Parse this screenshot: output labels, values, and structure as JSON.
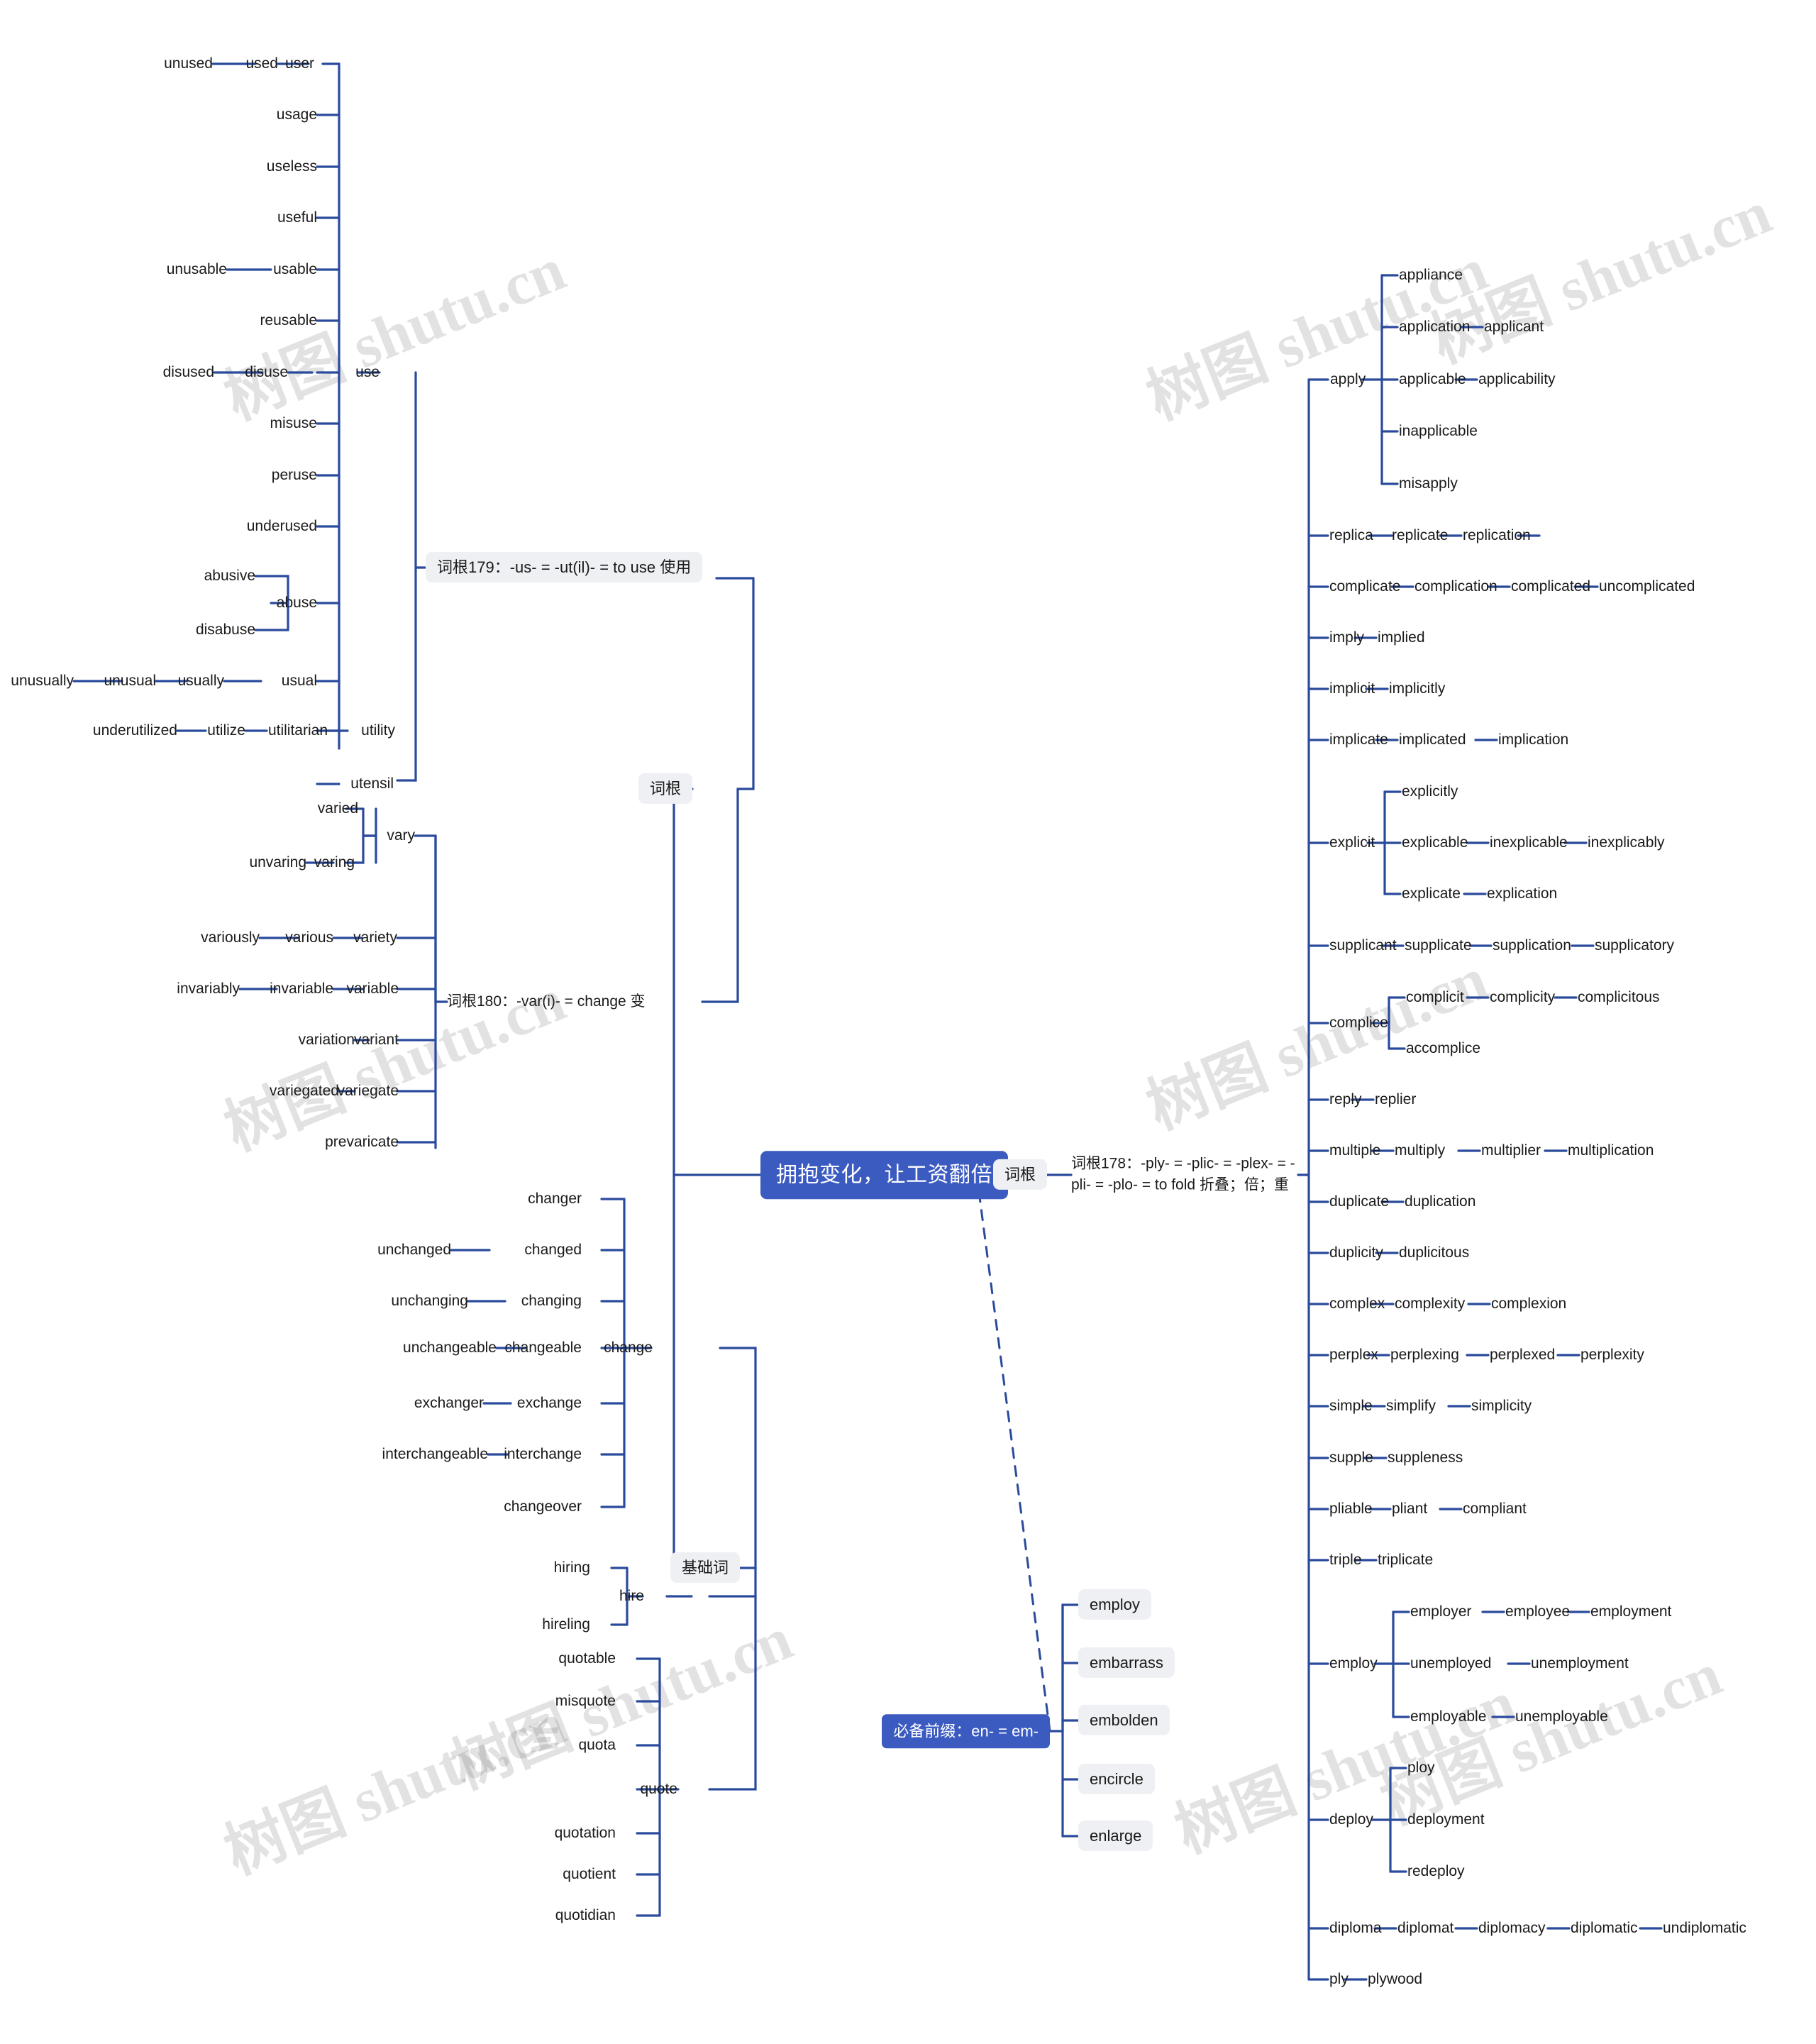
{
  "meta": {
    "watermark_text": "树图 shutu.cn",
    "accent_color": "#3b5bc0",
    "line_color": "#2a4a9c",
    "chip_bg": "#eef0f3"
  },
  "root": {
    "label": "拥抱变化，让工资翻倍"
  },
  "branches": {
    "cigen_left": {
      "label": "词根"
    },
    "cigen_right": {
      "label": "词根"
    },
    "jichuci": {
      "label": "基础词"
    },
    "bibei_qianzhui": {
      "label": "必备前缀：en- = em-"
    }
  },
  "roots": {
    "r179": {
      "label": "词根179：-us- = -ut(il)- = to use 使用"
    },
    "r180": {
      "label": "词根180：-var(i)- = change 变"
    },
    "r178": {
      "label": "词根178：-ply- = -plic- = -plex- = -pli- = -plo- = to fold 折叠；倍；重"
    }
  },
  "words": {
    "unused": "unused",
    "used": "used",
    "user": "user",
    "usage": "usage",
    "useless": "useless",
    "useful": "useful",
    "unusable": "unusable",
    "usable": "usable",
    "reusable": "reusable",
    "disused": "disused",
    "disuse": "disuse",
    "use": "use",
    "misuse": "misuse",
    "peruse": "peruse",
    "underused": "underused",
    "abusive": "abusive",
    "abuse": "abuse",
    "disabuse": "disabuse",
    "unusually": "unusually",
    "unusual": "unusual",
    "usually": "usually",
    "usual": "usual",
    "underutilized": "underutilized",
    "utilize": "utilize",
    "utilitarian": "utilitarian",
    "utility": "utility",
    "utensil": "utensil",
    "varied": "varied",
    "vary": "vary",
    "unvaring": "unvaring",
    "varing": "varing",
    "variously": "variously",
    "various": "various",
    "variety": "variety",
    "invariably": "invariably",
    "invariable": "invariable",
    "variable": "variable",
    "variation": "variation",
    "variant": "variant",
    "variegated": "variegated",
    "variegate": "variegate",
    "prevaricate": "prevaricate",
    "changer": "changer",
    "unchanged": "unchanged",
    "changed": "changed",
    "unchanging": "unchanging",
    "changing": "changing",
    "unchangeable": "unchangeable",
    "changeable": "changeable",
    "change": "change",
    "exchanger": "exchanger",
    "exchange": "exchange",
    "interchangeable": "interchangeable",
    "interchange": "interchange",
    "changeover": "changeover",
    "hiring": "hiring",
    "hire": "hire",
    "hireling": "hireling",
    "quotable": "quotable",
    "misquote": "misquote",
    "quota": "quota",
    "quote": "quote",
    "quotation": "quotation",
    "quotient": "quotient",
    "quotidian": "quotidian",
    "employ_p": "employ",
    "embarrass": "embarrass",
    "embolden": "embolden",
    "encircle": "encircle",
    "enlarge": "enlarge",
    "appliance": "appliance",
    "application": "application",
    "applicant": "applicant",
    "apply": "apply",
    "applicable": "applicable",
    "applicability": "applicability",
    "inapplicable": "inapplicable",
    "misapply": "misapply",
    "replica": "replica",
    "replicate": "replicate",
    "replication": "replication",
    "complicate": "complicate",
    "complication": "complication",
    "complicated": "complicated",
    "uncomplicated": "uncomplicated",
    "imply": "imply",
    "implied": "implied",
    "implicit": "implicit",
    "implicitly": "implicitly",
    "implicate": "implicate",
    "implicated": "implicated",
    "implication": "implication",
    "explicitly": "explicitly",
    "explicit": "explicit",
    "explicable": "explicable",
    "inexplicable": "inexplicable",
    "inexplicably": "inexplicably",
    "explicate": "explicate",
    "explication": "explication",
    "supplicant": "supplicant",
    "supplicate": "supplicate",
    "supplication": "supplication",
    "supplicatory": "supplicatory",
    "complicit": "complicit",
    "complicity": "complicity",
    "complicitous": "complicitous",
    "complice": "complice",
    "accomplice": "accomplice",
    "reply": "reply",
    "replier": "replier",
    "multiple": "multiple",
    "multiply": "multiply",
    "multiplier": "multiplier",
    "multiplication": "multiplication",
    "duplicate": "duplicate",
    "duplication": "duplication",
    "duplicity": "duplicity",
    "duplicitous": "duplicitous",
    "complex": "complex",
    "complexity": "complexity",
    "complexion": "complexion",
    "perplex": "perplex",
    "perplexing": "perplexing",
    "perplexed": "perplexed",
    "perplexity": "perplexity",
    "simple": "simple",
    "simplify": "simplify",
    "simplicity": "simplicity",
    "supple": "supple",
    "suppleness": "suppleness",
    "pliable": "pliable",
    "pliant": "pliant",
    "compliant": "compliant",
    "triple": "triple",
    "triplicate": "triplicate",
    "employer": "employer",
    "employee": "employee",
    "employment": "employment",
    "employ": "employ",
    "unemployed": "unemployed",
    "unemployment": "unemployment",
    "employable": "employable",
    "unemployable": "unemployable",
    "ploy": "ploy",
    "deploy": "deploy",
    "deployment": "deployment",
    "redeploy": "redeploy",
    "diploma": "diploma",
    "diplomat": "diplomat",
    "diplomacy": "diplomacy",
    "diplomatic": "diplomatic",
    "undiplomatic": "undiplomatic",
    "ply": "ply",
    "plywood": "plywood"
  }
}
